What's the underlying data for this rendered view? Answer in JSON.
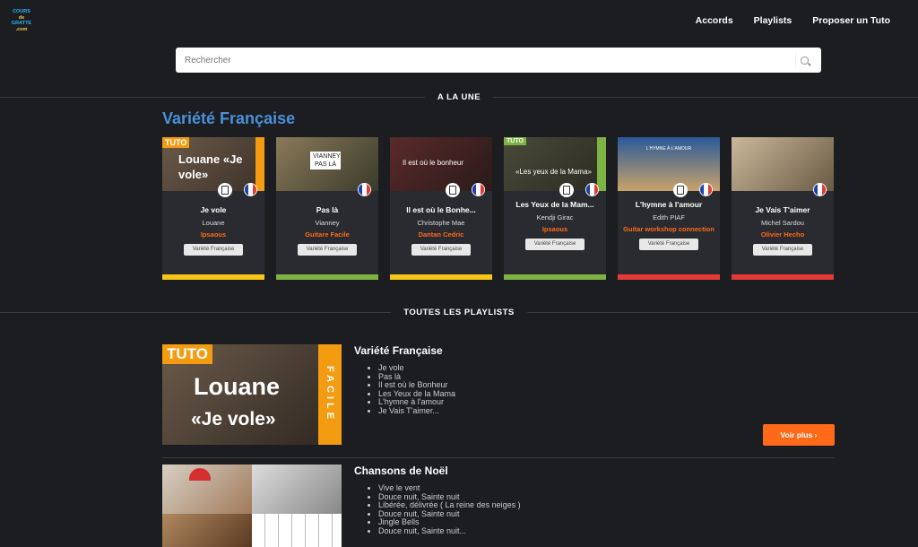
{
  "logo": {
    "line1": "COURS",
    "line2": "de",
    "line3": "GRATTE",
    "line4": ".com"
  },
  "nav": [
    "Accords",
    "Playlists",
    "Proposer un Tuto"
  ],
  "search": {
    "placeholder": "Rechercher"
  },
  "sections": {
    "featured": "A LA UNE",
    "playlists": "TOUTES LES PLAYLISTS"
  },
  "featured_title": "Variété Française",
  "cards": [
    {
      "title": "Je vole",
      "artist": "Louane",
      "author": "Ipsaous",
      "tag": "Variété Française",
      "bar": "#f5c518",
      "thumb_text": "Louane «Je vole»",
      "badge": "TUTO"
    },
    {
      "title": "Pas là",
      "artist": "Vianney",
      "author": "Guitare Facile",
      "tag": "Variété Française",
      "bar": "#7cb342",
      "thumb_text": "VIANNEY PAS LÀ",
      "badge": ""
    },
    {
      "title": "Il est où le Bonhe...",
      "artist": "Christophe Mae",
      "author": "Dantan Cedric",
      "tag": "Variété Française",
      "bar": "#f5c518",
      "thumb_text": "Il est où le bonheur",
      "badge": ""
    },
    {
      "title": "Les Yeux de la Mam...",
      "artist": "Kendji Girac",
      "author": "Ipsaous",
      "tag": "Variété Française",
      "bar": "#7cb342",
      "thumb_text": "«Les yeux de la Mama»",
      "badge": "TUTO"
    },
    {
      "title": "L'hymne à l'amour",
      "artist": "Edith PIAF",
      "author": "Guitar workshop connection",
      "tag": "Variété Française",
      "bar": "#e53935",
      "thumb_text": "L'HYMNE À L'AMOUR",
      "badge": ""
    },
    {
      "title": "Je Vais T'aimer",
      "artist": "Michel Sardou",
      "author": "Olivier Hecho",
      "tag": "Variété Française",
      "bar": "#e53935",
      "thumb_text": "",
      "badge": ""
    }
  ],
  "playlists": [
    {
      "title": "Variété Française",
      "items": [
        "Je vole",
        "Pas là",
        "Il est où le Bonheur",
        "Les Yeux de la Mama",
        "L'hymne à l'amour",
        "Je Vais T'aimer..."
      ],
      "button": "Voir plus",
      "thumb": {
        "badge": "TUTO",
        "line1": "Louane",
        "line2": "«Je vole»",
        "side": "FACILE"
      }
    },
    {
      "title": "Chansons de Noël",
      "items": [
        "Vive le vent",
        "Douce nuit, Sainte nuit",
        "Libérée, délivrée ( La reine des neiges )",
        "Douce nuit, Sainte nuit",
        "Jingle Bells",
        "Douce nuit, Sainte nuit..."
      ]
    }
  ],
  "colors": {
    "accent": "#ff6a1a",
    "title_blue": "#4a90d9",
    "bg": "#1c1d21"
  }
}
